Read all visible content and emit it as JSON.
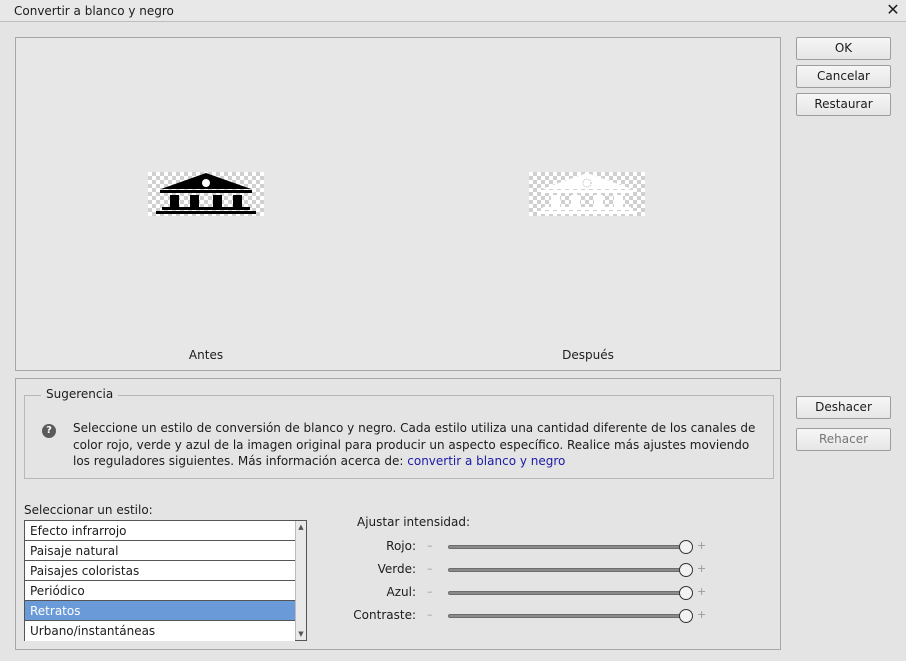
{
  "window": {
    "title": "Convertir a blanco y negro",
    "close_glyph": "✕"
  },
  "preview": {
    "before_label": "Antes",
    "after_label": "Después"
  },
  "buttons": {
    "ok": "OK",
    "cancel": "Cancelar",
    "restore": "Restaurar",
    "undo": "Deshacer",
    "redo": "Rehacer"
  },
  "hint": {
    "legend": "Sugerencia",
    "icon": "help-icon",
    "text": "Seleccione un estilo de conversión de blanco y negro. Cada estilo utiliza una cantidad diferente de los canales de color rojo, verde y azul de la imagen original para producir un aspecto específico. Realice más ajustes moviendo los reguladores siguientes. Más información acerca de:",
    "link": "convertir a blanco y negro"
  },
  "styles": {
    "label": "Seleccionar un estilo:",
    "items": [
      "Efecto infrarrojo",
      "Paisaje natural",
      "Paisajes coloristas",
      "Periódico",
      "Retratos",
      "Urbano/instantáneas"
    ],
    "selected": "Retratos"
  },
  "sliders": {
    "label": "Ajustar intensidad:",
    "minus": "–",
    "plus": "+",
    "items": [
      {
        "label": "Rojo:",
        "value": 1.0
      },
      {
        "label": "Verde:",
        "value": 1.0
      },
      {
        "label": "Azul:",
        "value": 1.0
      },
      {
        "label": "Contraste:",
        "value": 1.0
      }
    ]
  },
  "colors": {
    "selected_row": "#6a9bd8",
    "link": "#1a1aa6"
  }
}
